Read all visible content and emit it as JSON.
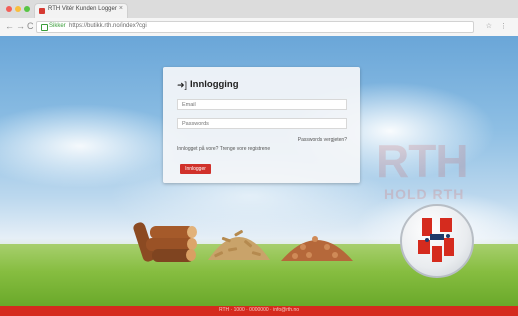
{
  "browser": {
    "tab_title": "RTH Vitér Kunden Logger",
    "tab_close": "×",
    "secure_label": "Sikker",
    "url": "https://butikk.rth.no/index?cgi",
    "nav_back": "←",
    "nav_forward": "→",
    "nav_reload": "C",
    "toolbar_icons": "☆ ⋮"
  },
  "login": {
    "icon": "sign-in-icon",
    "title": "Innlogging",
    "email_placeholder": "Email",
    "password_placeholder": "Passwords",
    "forgot_link": "Passwords vergjeten?",
    "register_text": "Innlogget på vore? Trenge vore registrene",
    "login_button": "Innlogger"
  },
  "branding": {
    "watermark": "RTH",
    "watermark_sub": "HOLD RTH",
    "accent_color": "#d52b1e"
  },
  "footer": {
    "text": "RTH · 1000 · 0000000 · info@rth.no"
  }
}
